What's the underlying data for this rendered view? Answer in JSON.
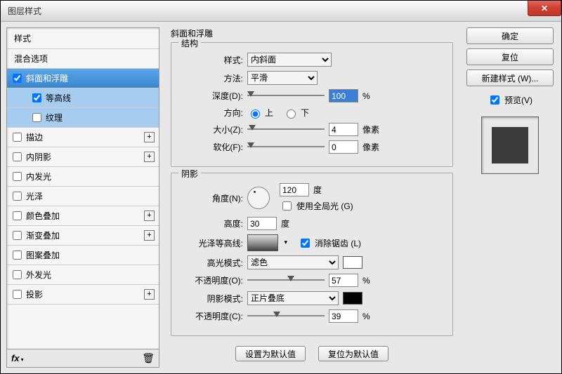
{
  "window": {
    "title": "图层样式",
    "close": "✕"
  },
  "sidebar": {
    "header": "样式",
    "subheader": "混合选项",
    "items": [
      {
        "label": "斜面和浮雕",
        "checked": true,
        "plus": false
      },
      {
        "label": "等高线",
        "checked": true,
        "plus": false,
        "indent": true
      },
      {
        "label": "纹理",
        "checked": false,
        "plus": false,
        "indent": true
      },
      {
        "label": "描边",
        "checked": false,
        "plus": true
      },
      {
        "label": "内阴影",
        "checked": false,
        "plus": true
      },
      {
        "label": "内发光",
        "checked": false,
        "plus": false
      },
      {
        "label": "光泽",
        "checked": false,
        "plus": false
      },
      {
        "label": "颜色叠加",
        "checked": false,
        "plus": true
      },
      {
        "label": "渐变叠加",
        "checked": false,
        "plus": true
      },
      {
        "label": "图案叠加",
        "checked": false,
        "plus": false
      },
      {
        "label": "外发光",
        "checked": false,
        "plus": false
      },
      {
        "label": "投影",
        "checked": false,
        "plus": true
      }
    ],
    "fx": "fx",
    "trash": "🗑"
  },
  "main": {
    "heading": "斜面和浮雕",
    "structure": {
      "title": "结构",
      "style_label": "样式:",
      "style_value": "内斜面",
      "technique_label": "方法:",
      "technique_value": "平滑",
      "depth_label": "深度(D):",
      "depth_value": "100",
      "depth_unit": "%",
      "direction_label": "方向:",
      "direction_up": "上",
      "direction_down": "下",
      "size_label": "大小(Z):",
      "size_value": "4",
      "size_unit": "像素",
      "soften_label": "软化(F):",
      "soften_value": "0",
      "soften_unit": "像素"
    },
    "shading": {
      "title": "阴影",
      "angle_label": "角度(N):",
      "angle_value": "120",
      "angle_unit": "度",
      "global_light": "使用全局光 (G)",
      "altitude_label": "高度:",
      "altitude_value": "30",
      "altitude_unit": "度",
      "gloss_label": "光泽等高线:",
      "antialias": "消除锯齿 (L)",
      "highlight_mode_label": "高光模式:",
      "highlight_mode_value": "滤色",
      "highlight_opacity_label": "不透明度(O):",
      "highlight_opacity_value": "57",
      "opacity_unit": "%",
      "shadow_mode_label": "阴影模式:",
      "shadow_mode_value": "正片叠底",
      "shadow_opacity_label": "不透明度(C):",
      "shadow_opacity_value": "39",
      "highlight_color": "#ffffff",
      "shadow_color": "#000000"
    },
    "buttons": {
      "make_default": "设置为默认值",
      "reset_default": "复位为默认值"
    }
  },
  "right": {
    "ok": "确定",
    "cancel": "复位",
    "new_style": "新建样式 (W)...",
    "preview": "预览(V)"
  }
}
